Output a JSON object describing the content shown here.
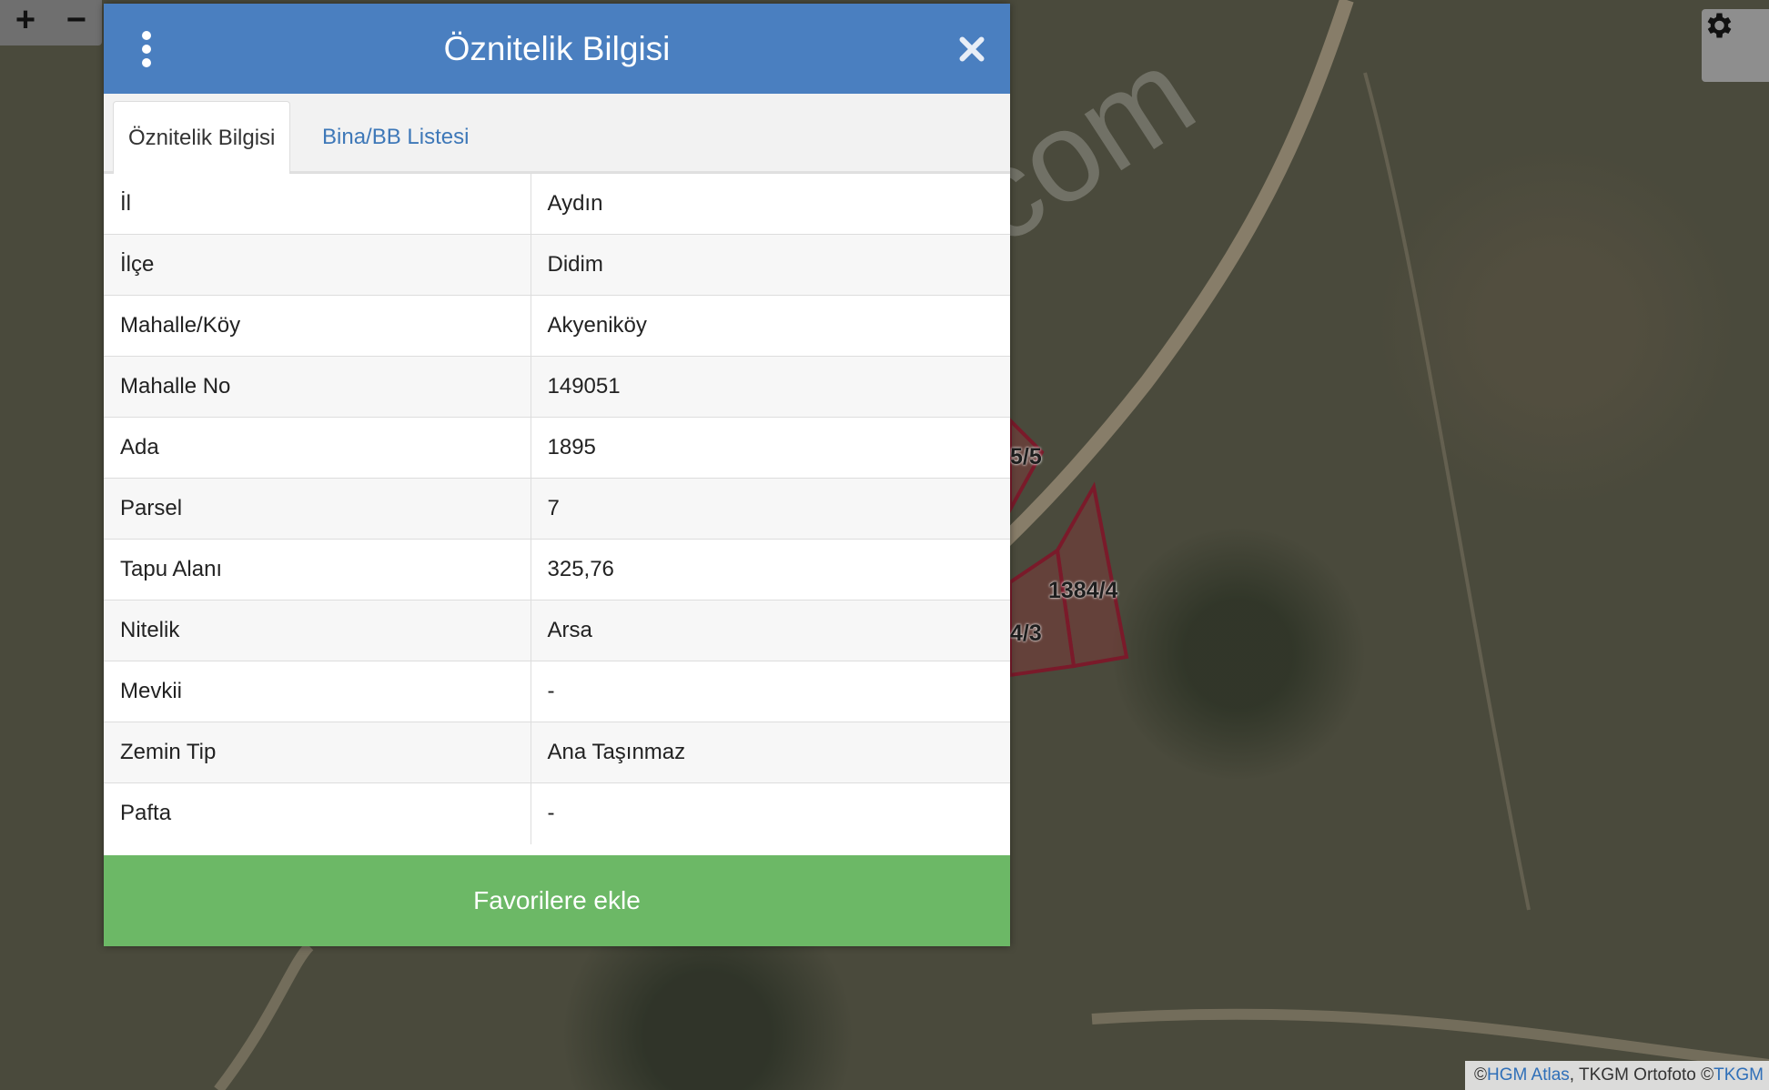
{
  "map": {
    "zoom_in_label": "+",
    "zoom_out_label": "−",
    "parcel_labels": [
      "5/5",
      "1384/4",
      "4/3"
    ],
    "watermark": "emlakjet.com",
    "attribution": {
      "prefix": "© ",
      "link1": "HGM Atlas",
      "middle": ", TKGM Ortofoto © ",
      "link2": "TKGM"
    },
    "colors": {
      "parcel_border": "#7a1a2a",
      "road": "#9c8f78"
    }
  },
  "dialog": {
    "title": "Öznitelik Bilgisi",
    "tabs": [
      {
        "label": "Öznitelik Bilgisi",
        "active": true
      },
      {
        "label": "Bina/BB Listesi",
        "active": false
      }
    ],
    "rows": [
      {
        "key": "İl",
        "value": "Aydın"
      },
      {
        "key": "İlçe",
        "value": "Didim"
      },
      {
        "key": "Mahalle/Köy",
        "value": "Akyeniköy"
      },
      {
        "key": "Mahalle No",
        "value": "149051"
      },
      {
        "key": "Ada",
        "value": "1895"
      },
      {
        "key": "Parsel",
        "value": "7"
      },
      {
        "key": "Tapu Alanı",
        "value": "325,76"
      },
      {
        "key": "Nitelik",
        "value": "Arsa"
      },
      {
        "key": "Mevkii",
        "value": "-"
      },
      {
        "key": "Zemin Tip",
        "value": "Ana Taşınmaz"
      },
      {
        "key": "Pafta",
        "value": "-"
      }
    ],
    "favorite_button": "Favorilere ekle",
    "colors": {
      "header": "#4a7fc0",
      "button": "#6cb866",
      "tab_link": "#3e78b8"
    }
  }
}
